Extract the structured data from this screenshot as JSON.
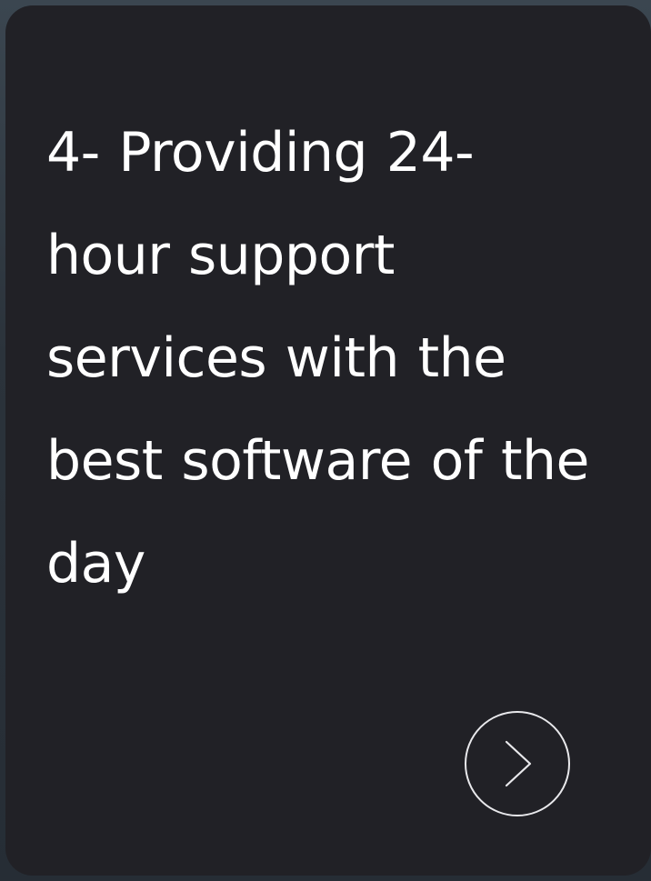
{
  "card": {
    "text": "4- Providing 24-hour support services with the best software of the day",
    "next_button": {
      "icon": "chevron-right-icon"
    }
  },
  "colors": {
    "card_background": "#212126",
    "text": "#ffffff",
    "button_outline": "#e9e9ec"
  }
}
